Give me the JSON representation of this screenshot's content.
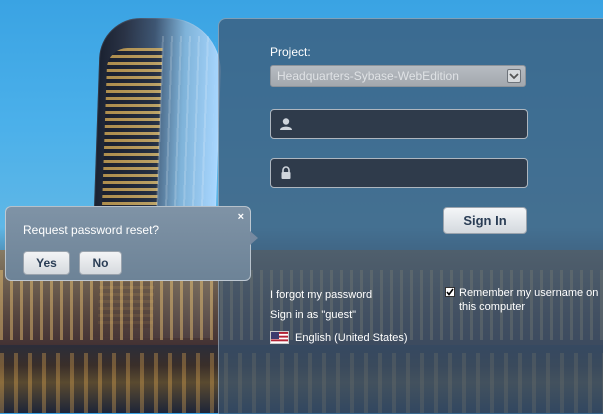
{
  "login": {
    "project_label": "Project:",
    "project_selected": "Headquarters-Sybase-WebEdition",
    "username_placeholder": "",
    "password_placeholder": "",
    "signin_label": "Sign In",
    "forgot_password": "I forgot my password",
    "guest_signin": "Sign in as \"guest\"",
    "remember_label": "Remember my username on this computer",
    "remember_checked": true,
    "language": "English (United States)"
  },
  "popup": {
    "title": "Request password reset?",
    "yes_label": "Yes",
    "no_label": "No",
    "close_glyph": "×"
  },
  "icons": {
    "user": "user-icon",
    "lock": "lock-icon",
    "dropdown": "chevron-down-icon",
    "flag": "us-flag-icon",
    "close": "close-icon"
  },
  "colors": {
    "panel": "#3a5470",
    "button_text": "#2a3d55",
    "field_bg": "#2f3b4b"
  }
}
